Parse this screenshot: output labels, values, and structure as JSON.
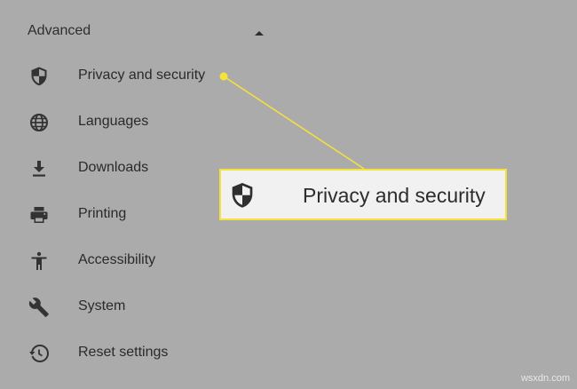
{
  "section": {
    "title": "Advanced",
    "expanded": true
  },
  "menu": {
    "items": [
      {
        "label": "Privacy and security",
        "icon": "shield-icon"
      },
      {
        "label": "Languages",
        "icon": "globe-icon"
      },
      {
        "label": "Downloads",
        "icon": "download-icon"
      },
      {
        "label": "Printing",
        "icon": "printer-icon"
      },
      {
        "label": "Accessibility",
        "icon": "accessibility-icon"
      },
      {
        "label": "System",
        "icon": "wrench-icon"
      },
      {
        "label": "Reset settings",
        "icon": "history-icon"
      }
    ]
  },
  "callout": {
    "label": "Privacy and security",
    "icon": "shield-icon",
    "highlight_color": "#f4e33a"
  },
  "watermark": "wsxdn.com"
}
